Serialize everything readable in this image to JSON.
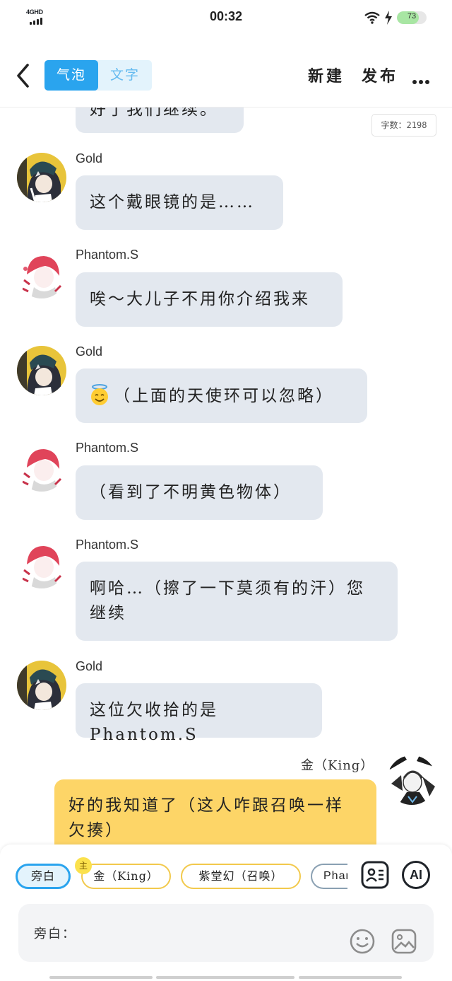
{
  "status_bar": {
    "network": "4GHD",
    "time": "00:32",
    "battery": "73",
    "battery_level": 0.73
  },
  "header": {
    "tabs": [
      {
        "label": "气泡",
        "active": true
      },
      {
        "label": "文字",
        "active": false
      }
    ],
    "new_label": "新建",
    "publish_label": "发布",
    "more_icon": "more-dots-icon"
  },
  "word_count": "字数：2198",
  "messages": [
    {
      "sender": "",
      "text": "好了我们继续。",
      "side": "left"
    },
    {
      "sender": "Gold",
      "text": "这个戴眼镜的是……",
      "side": "left"
    },
    {
      "sender": "Phantom.S",
      "text": "唉～大儿子不用你介绍我来",
      "side": "left"
    },
    {
      "sender": "Gold",
      "emoji": "halo-smiley-icon",
      "text": "（上面的天使环可以忽略）",
      "side": "left"
    },
    {
      "sender": "Phantom.S",
      "text": "（看到了不明黄色物体）",
      "side": "left"
    },
    {
      "sender": "Phantom.S",
      "text_line1": "啊哈…（擦了一下莫须有的汗）您",
      "text_line2": "继续",
      "side": "left"
    },
    {
      "sender": "Gold",
      "text": "这位欠收拾的是Phantom.S",
      "side": "left"
    },
    {
      "sender": "金（King）",
      "text_line1": "好的我知道了（这人咋跟召唤一样",
      "text_line2": "欠揍）",
      "side": "right"
    }
  ],
  "role_chips": [
    {
      "label": "旁白",
      "selected": true
    },
    {
      "label": "金（King）",
      "badge": "主"
    },
    {
      "label": "紫堂幻（召唤）"
    },
    {
      "label": "Phan"
    }
  ],
  "tools": {
    "role_card_icon": "contact-card-icon",
    "ai_label": "AI"
  },
  "input": {
    "label": "旁白：",
    "emoji_icon": "smiley-icon",
    "image_icon": "image-icon"
  },
  "colors": {
    "accent": "#2aa4ee",
    "my_bubble": "#fdd567",
    "other_bubble": "#e3e8ef",
    "chip_border": "#f2c94c"
  }
}
